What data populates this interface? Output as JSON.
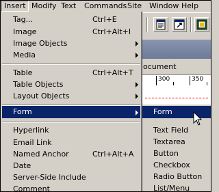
{
  "menubar": {
    "items": [
      "Insert",
      "Modify",
      "Text",
      "Commands",
      "Site",
      "Window",
      "Help"
    ],
    "active": "Insert"
  },
  "background": {
    "doc_tab": "ocument",
    "ruler": [
      "300",
      "350"
    ]
  },
  "menu": {
    "tag": {
      "label": "Tag...",
      "shortcut": "Ctrl+E"
    },
    "image": {
      "label": "Image",
      "shortcut": "Ctrl+Alt+I"
    },
    "image_objects": {
      "label": "Image Objects"
    },
    "media": {
      "label": "Media"
    },
    "table": {
      "label": "Table",
      "shortcut": "Ctrl+Alt+T"
    },
    "table_objects": {
      "label": "Table Objects"
    },
    "layout_objects": {
      "label": "Layout Objects"
    },
    "form": {
      "label": "Form"
    },
    "hyperlink": {
      "label": "Hyperlink"
    },
    "email_link": {
      "label": "Email Link"
    },
    "named_anchor": {
      "label": "Named Anchor",
      "shortcut": "Ctrl+Alt+A"
    },
    "date": {
      "label": "Date"
    },
    "server_side": {
      "label": "Server-Side Include"
    },
    "comment": {
      "label": "Comment"
    }
  },
  "submenu": {
    "items": [
      "Form",
      "Text Field",
      "Textarea",
      "Button",
      "Checkbox",
      "Radio Button",
      "List/Menu"
    ],
    "highlighted": "Form"
  },
  "colors": {
    "menu_bg": "#d4d0c8",
    "highlight": "#0a246a",
    "highlight_text": "#ffffff"
  },
  "icons": [
    "toolbar-page-icon",
    "toolbar-link-icon",
    "toolbar-image-icon",
    "submenu-arrow-icon",
    "mouse-cursor-icon"
  ]
}
